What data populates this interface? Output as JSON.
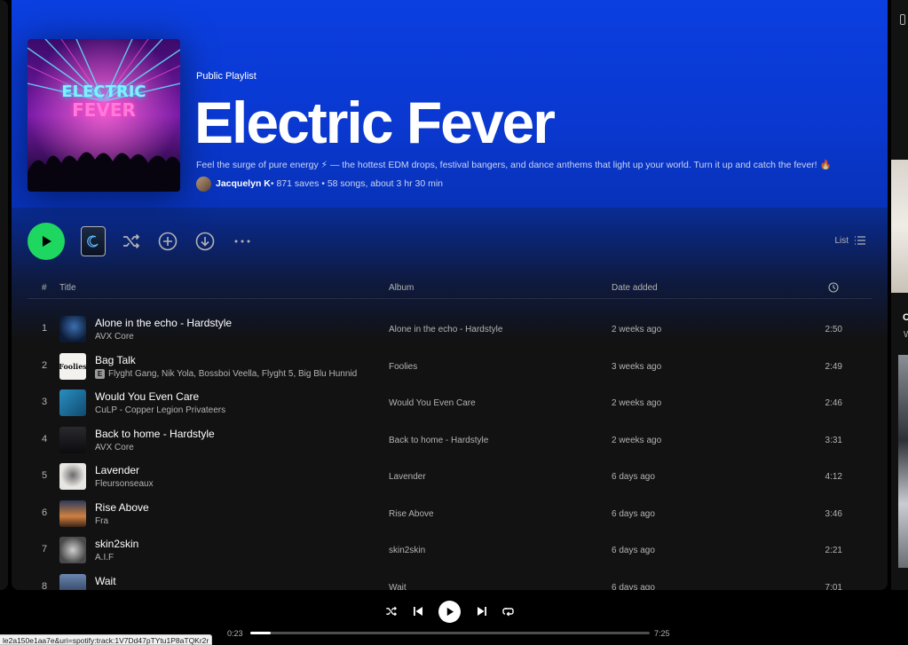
{
  "playlist": {
    "kicker": "Public Playlist",
    "title": "Electric Fever",
    "cover_text_line1": "ELECTRIC",
    "cover_text_line2": "FEVER",
    "description": "Feel the surge of pure energy ⚡ — the hottest EDM drops, festival bangers, and dance anthems that light up your world. Turn it up and catch the fever! 🔥",
    "owner": "Jacquelyn K",
    "stats": " • 871 saves • 58 songs, about 3 hr 30 min"
  },
  "controls": {
    "list_label": "List"
  },
  "table": {
    "columns": {
      "num": "#",
      "title": "Title",
      "album": "Album",
      "date_added": "Date added"
    },
    "rows": [
      {
        "num": "1",
        "title": "Alone in the echo - Hardstyle",
        "artist": "AVX Core",
        "explicit": false,
        "album": "Alone in the echo - Hardstyle",
        "date": "2 weeks ago",
        "duration": "2:50"
      },
      {
        "num": "2",
        "title": "Bag Talk",
        "artist": "Flyght Gang, Nik Yola, Bossboi Veella, Flyght 5, Big Blu Hunnid",
        "explicit": true,
        "album": "Foolies",
        "date": "3 weeks ago",
        "duration": "2:49"
      },
      {
        "num": "3",
        "title": "Would You Even Care",
        "artist": "CuLP - Copper Legion Privateers",
        "explicit": false,
        "album": "Would You Even Care",
        "date": "2 weeks ago",
        "duration": "2:46"
      },
      {
        "num": "4",
        "title": "Back to home - Hardstyle",
        "artist": "AVX Core",
        "explicit": false,
        "album": "Back to home - Hardstyle",
        "date": "2 weeks ago",
        "duration": "3:31"
      },
      {
        "num": "5",
        "title": "Lavender",
        "artist": "Fleursonseaux",
        "explicit": false,
        "album": "Lavender",
        "date": "6 days ago",
        "duration": "4:12"
      },
      {
        "num": "6",
        "title": "Rise Above",
        "artist": "Fra",
        "explicit": false,
        "album": "Rise Above",
        "date": "6 days ago",
        "duration": "3:46"
      },
      {
        "num": "7",
        "title": "skin2skin",
        "artist": "A.I.F",
        "explicit": false,
        "album": "skin2skin",
        "date": "6 days ago",
        "duration": "2:21"
      },
      {
        "num": "8",
        "title": "Wait",
        "artist": "",
        "explicit": false,
        "album": "Wait",
        "date": "6 days ago",
        "duration": "7:01"
      }
    ],
    "explicit_badge": "E",
    "thumb_text_2": "Foolies"
  },
  "player": {
    "elapsed": "0:23",
    "total": "7:25",
    "progress": 0.052
  },
  "right": {
    "text1": "C",
    "text2": "W"
  },
  "status_url": "le2a150e1aa7e&uri=spotify:track:1V7Dd47pTYtu1P8aTQKr2r",
  "colors": {
    "accent": "#1ed760",
    "header": "#0b3fe0"
  }
}
